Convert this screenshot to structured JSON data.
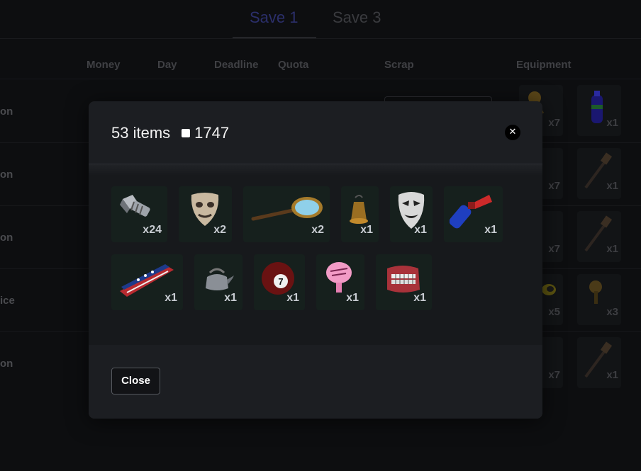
{
  "tabs": [
    {
      "label": "Save 1",
      "active": true
    },
    {
      "label": "Save 3",
      "active": false
    }
  ],
  "columns": [
    "Money",
    "Day",
    "Deadline",
    "Quota",
    "Scrap",
    "Equipment"
  ],
  "rows": [
    {
      "label": "on",
      "equipment_counts": [
        "x7",
        "x1"
      ]
    },
    {
      "label": "on",
      "equipment_counts": [
        "x7",
        "x1"
      ]
    },
    {
      "label": "on",
      "equipment_counts": [
        "x7",
        "x1"
      ]
    },
    {
      "label": "ice",
      "equipment_counts": [
        "x5",
        "x3"
      ]
    },
    {
      "label": "on",
      "equipment_counts": [
        "x7",
        "x1"
      ]
    }
  ],
  "modal": {
    "item_count_text": "53 items",
    "value_text": "1747",
    "close_icon": "close-icon",
    "close_label": "Close",
    "items": [
      {
        "name": "large-bolt",
        "icon": "bolt-icon",
        "qty": "x24"
      },
      {
        "name": "comedy-mask",
        "icon": "mask-icon",
        "qty": "x2"
      },
      {
        "name": "magnifying-glass",
        "icon": "magnifying-glass-icon",
        "qty": "x2"
      },
      {
        "name": "bell",
        "icon": "bell-icon",
        "qty": "x1"
      },
      {
        "name": "tragedy-mask",
        "icon": "mask-icon",
        "qty": "x1"
      },
      {
        "name": "air-horn",
        "icon": "air-horn-icon",
        "qty": "x1"
      },
      {
        "name": "flag-toy",
        "icon": "flag-toy-icon",
        "qty": "x1"
      },
      {
        "name": "tea-kettle",
        "icon": "kettle-icon",
        "qty": "x1"
      },
      {
        "name": "pool-ball",
        "icon": "pool-ball-icon",
        "qty": "x1"
      },
      {
        "name": "whoopie-cushion",
        "icon": "whoopie-cushion-icon",
        "qty": "x1"
      },
      {
        "name": "teeth",
        "icon": "teeth-icon",
        "qty": "x1"
      }
    ]
  },
  "colors": {
    "background": "#0d0e10",
    "modal": "#1c1e22",
    "item_tile": "#16201d",
    "active_tab": "#2b2f6b"
  }
}
